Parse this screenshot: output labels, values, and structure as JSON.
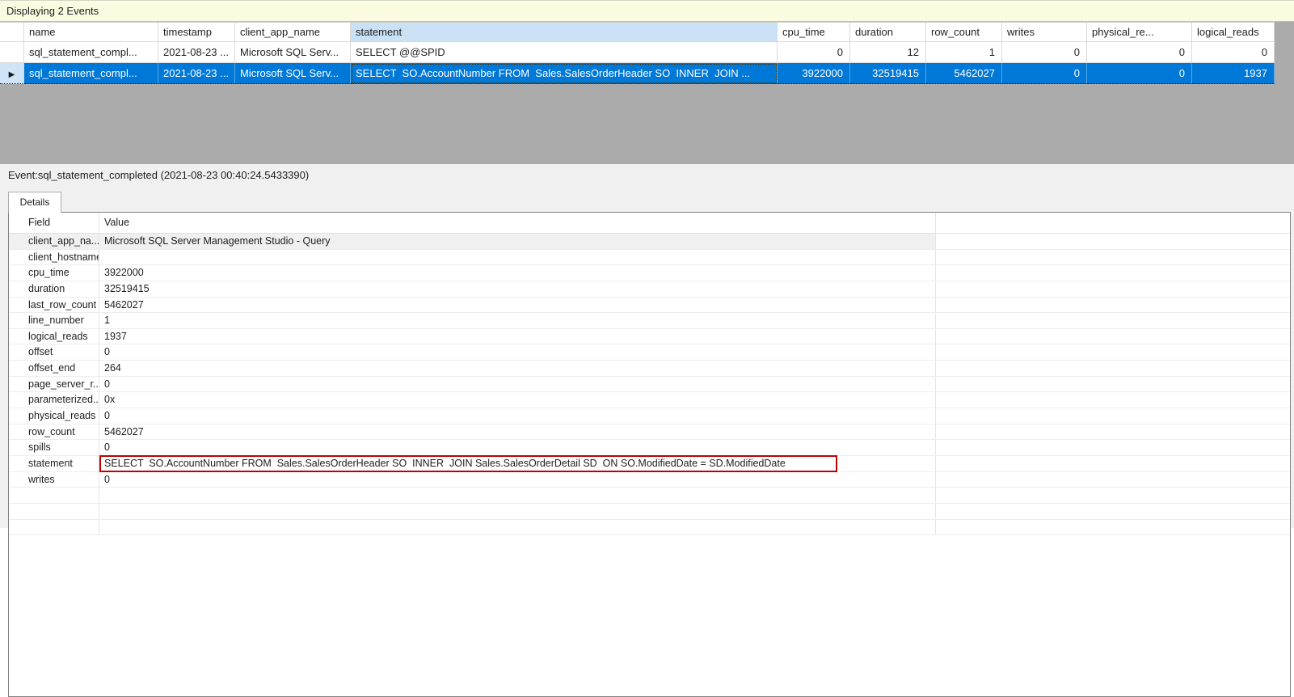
{
  "header_bar": {
    "text": "Displaying 2 Events"
  },
  "colors": {
    "selection_blue": "#0078D7",
    "selector_light_blue": "#CFE4F7",
    "statement_header_highlight": "#C9E0F5",
    "red_annotation_box": "#C00000",
    "bar_yellow": "#FBFBE1",
    "gray_zone": "#ABABAB",
    "section_bg": "#F0F0F0"
  },
  "events_grid": {
    "columns": [
      {
        "key": "name",
        "label": "name",
        "align": "left"
      },
      {
        "key": "timestamp",
        "label": "timestamp",
        "align": "left"
      },
      {
        "key": "client_app_name",
        "label": "client_app_name",
        "align": "left"
      },
      {
        "key": "statement",
        "label": "statement",
        "align": "left",
        "highlighted": true
      },
      {
        "key": "cpu_time",
        "label": "cpu_time",
        "align": "right"
      },
      {
        "key": "duration",
        "label": "duration",
        "align": "right"
      },
      {
        "key": "row_count",
        "label": "row_count",
        "align": "right"
      },
      {
        "key": "writes",
        "label": "writes",
        "align": "right"
      },
      {
        "key": "physical_reads",
        "label": "physical_re...",
        "align": "right"
      },
      {
        "key": "logical_reads",
        "label": "logical_reads",
        "align": "right"
      }
    ],
    "rows": [
      {
        "selected": false,
        "cells": [
          "sql_statement_compl...",
          "2021-08-23 ...",
          "Microsoft SQL Serv...",
          "SELECT @@SPID",
          "0",
          "12",
          "1",
          "0",
          "0",
          "0"
        ]
      },
      {
        "selected": true,
        "cells": [
          "sql_statement_compl...",
          "2021-08-23 ...",
          "Microsoft SQL Serv...",
          "SELECT  SO.AccountNumber FROM  Sales.SalesOrderHeader SO  INNER  JOIN ...",
          "3922000",
          "32519415",
          "5462027",
          "0",
          "0",
          "1937"
        ]
      }
    ]
  },
  "event_detail": {
    "title": "Event:sql_statement_completed (2021-08-23 00:40:24.5433390)",
    "tab_label": "Details",
    "table": {
      "field_header": "Field",
      "value_header": "Value",
      "rows": [
        {
          "field": "client_app_na...",
          "value": "Microsoft SQL Server Management Studio - Query",
          "highlight": true
        },
        {
          "field": "client_hostname",
          "value": ""
        },
        {
          "field": "cpu_time",
          "value": "3922000"
        },
        {
          "field": "duration",
          "value": "32519415"
        },
        {
          "field": "last_row_count",
          "value": "5462027"
        },
        {
          "field": "line_number",
          "value": "1"
        },
        {
          "field": "logical_reads",
          "value": "1937"
        },
        {
          "field": "offset",
          "value": "0"
        },
        {
          "field": "offset_end",
          "value": "264"
        },
        {
          "field": "page_server_r...",
          "value": "0"
        },
        {
          "field": "parameterized...",
          "value": "0x"
        },
        {
          "field": "physical_reads",
          "value": "0"
        },
        {
          "field": "row_count",
          "value": "5462027"
        },
        {
          "field": "spills",
          "value": "0"
        },
        {
          "field": "statement",
          "value": "SELECT  SO.AccountNumber FROM  Sales.SalesOrderHeader SO  INNER  JOIN Sales.SalesOrderDetail SD  ON SO.ModifiedDate = SD.ModifiedDate",
          "boxed": true
        },
        {
          "field": "writes",
          "value": "0"
        }
      ]
    }
  }
}
